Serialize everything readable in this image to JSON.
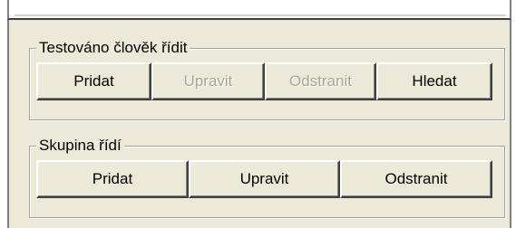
{
  "group_tested_person": {
    "title": "Testováno člověk řídit",
    "buttons": [
      {
        "label": "Pridat",
        "enabled": true
      },
      {
        "label": "Upravit",
        "enabled": false
      },
      {
        "label": "Odstranit",
        "enabled": false
      },
      {
        "label": "Hledat",
        "enabled": true
      }
    ]
  },
  "group_control": {
    "title": "Skupina řídí",
    "buttons": [
      {
        "label": "Pridat",
        "enabled": true
      },
      {
        "label": "Upravit",
        "enabled": true
      },
      {
        "label": "Odstranit",
        "enabled": true
      }
    ]
  }
}
